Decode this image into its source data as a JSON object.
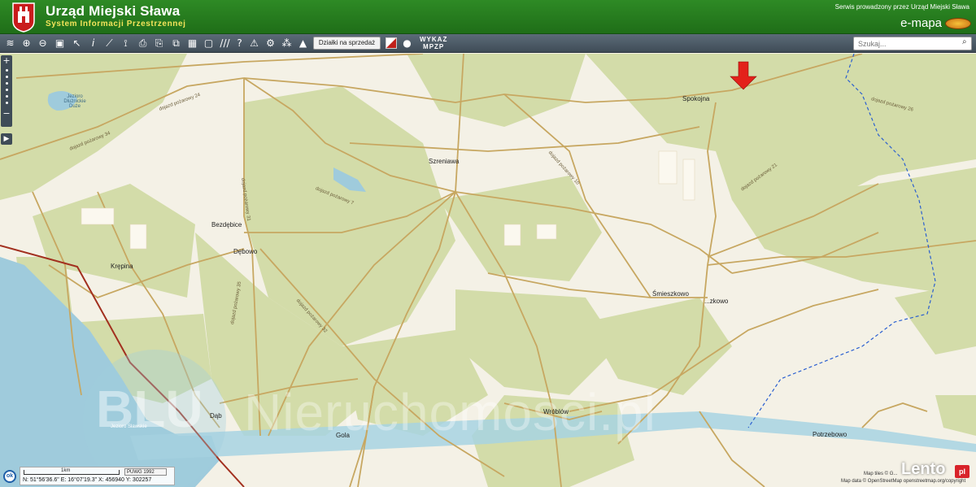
{
  "header": {
    "title": "Urząd Miejski Sława",
    "subtitle": "System Informacji Przestrzennej",
    "service_note": "Serwis prowadzony przez Urząd Miejski Sława",
    "brand": "e-mapa"
  },
  "toolbar": {
    "icons": [
      "layers-icon",
      "zoom-in-icon",
      "zoom-out-icon",
      "zoom-extent-icon",
      "pointer-icon",
      "info-icon",
      "measure-line-icon",
      "measure-area-icon",
      "print-icon",
      "copy-icon",
      "layout-icon",
      "comment-icon",
      "hatch-icon",
      "help-icon",
      "warning-icon",
      "settings-icon",
      "parcel-icon"
    ],
    "parcels_for_sale_label": "Działki na sprzedaż",
    "wykaz_label_1": "WYKAZ",
    "wykaz_label_2": "MPZP",
    "search_placeholder": "Szukaj..."
  },
  "map": {
    "places": [
      "Spokojna",
      "Szreniawa",
      "Bezdębice",
      "Dębowo",
      "Krępina",
      "Śmieszkowo",
      "...zkowo",
      "Wróblów",
      "Dąb",
      "Gola",
      "Potrzebowo",
      "Jezioro Dlużnickie Duże",
      "Jezioro Sławskie"
    ],
    "roads": [
      "dojazd pożarowy 34",
      "dojazd pożarowy 24",
      "dojazd pożarowy 7",
      "dojazd pożarowy 26",
      "dojazd pożarowy 21",
      "dojazd pożarowy 31",
      "dojazd pożarowy 35",
      "dojazd pożarowy 10",
      "dojazd pożarowy 32"
    ],
    "watermark_1": "BLU",
    "watermark_2": "Nieruchomosci.pl"
  },
  "status": {
    "ok_label": "ok",
    "scale_label": "1km",
    "crs": "PUWG 1992",
    "coords": "N: 51°56'36.6\"  E: 16°07'19.3\"  X: 456940     Y: 302257"
  },
  "attribution": {
    "tiles": "Map tiles © G...",
    "data": "Map data © OpenStreetMap openstreetmap.org/copyright"
  },
  "overlay": {
    "brand": "Lento",
    "brand_suffix": "pl"
  },
  "colors": {
    "header_green": "#2e8a25",
    "subtitle_yellow": "#f2e35a",
    "forest": "#d3dca9",
    "field": "#f4f1e6",
    "road": "#c7a761",
    "water": "#9fcbdc",
    "boundary": "#2a5fd0",
    "rail": "#a2301f",
    "marker": "#e3211a"
  }
}
